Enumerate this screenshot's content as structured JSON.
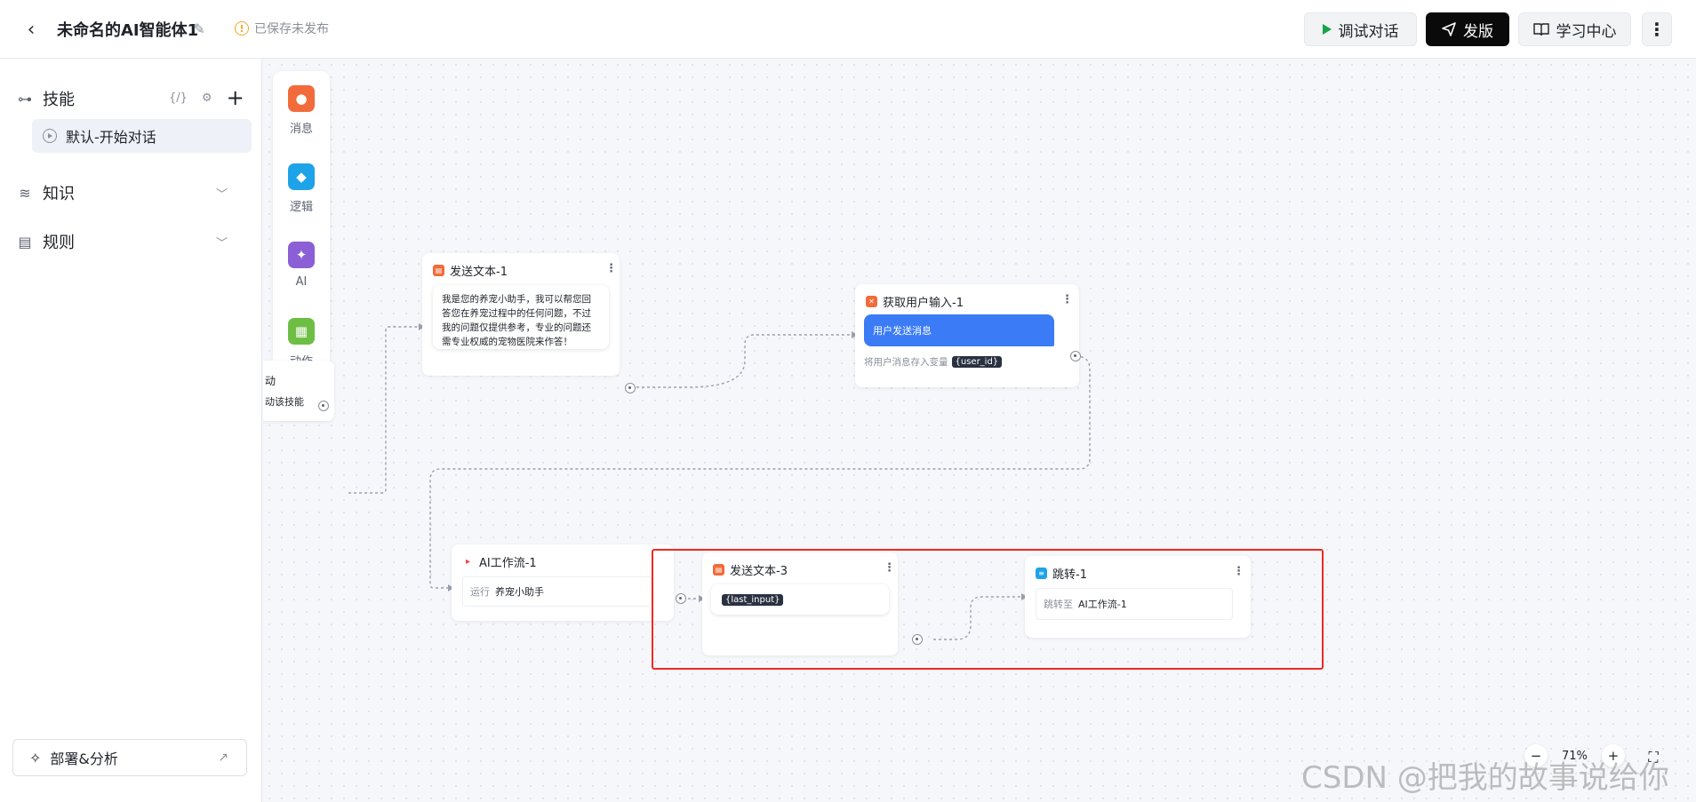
{
  "header": {
    "back_icon": "chevron-left-icon",
    "title": "未命名的AI智能体1",
    "edit_icon": "pencil-icon",
    "save_status": "已保存未发布",
    "debug_label": "调试对话",
    "publish_label": "发版",
    "learn_label": "学习中心",
    "more_icon": "more-vertical-icon"
  },
  "sidebar": {
    "skill_label": "技能",
    "skill_tools": [
      "{/}",
      "⚙"
    ],
    "skill_item": "默认-开始对话",
    "knowledge_label": "知识",
    "rules_label": "规则",
    "deploy_label": "部署&分析"
  },
  "palette": {
    "items": [
      {
        "label": "消息",
        "icon": "chat-icon",
        "color": "#f26b3a"
      },
      {
        "label": "逻辑",
        "icon": "bulb-icon",
        "color": "#1fa3e8"
      },
      {
        "label": "AI",
        "icon": "magic-wand-icon",
        "color": "#8b5fd6"
      },
      {
        "label": "动作",
        "icon": "grid-icon",
        "color": "#6fbe44"
      }
    ]
  },
  "nodes": {
    "start": {
      "title": "动",
      "desc": "动该技能"
    },
    "send1": {
      "title": "发送文本-1",
      "text": "我是您的养宠小助手，我可以帮您回答您在养宠过程中的任何问题，不过我的问题仅提供参考，专业的问题还需专业权威的宠物医院来作答！"
    },
    "get_input": {
      "title": "获取用户输入-1",
      "message": "用户发送消息",
      "save_label": "将用户消息存入变量",
      "var": "{user_id}"
    },
    "ai_flow": {
      "title": "AI工作流-1",
      "run_label": "运行",
      "run_value": "养宠小助手"
    },
    "send3": {
      "title": "发送文本-3",
      "var": "{last_input}"
    },
    "jump": {
      "title": "跳转-1",
      "label": "跳转至",
      "target": "AI工作流-1"
    }
  },
  "zoom": {
    "level": "71%"
  },
  "watermark": "CSDN @把我的故事说给你"
}
